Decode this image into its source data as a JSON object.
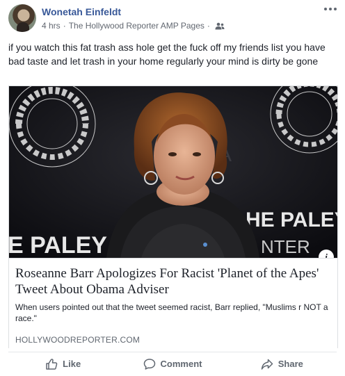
{
  "post": {
    "author": "Wonetah Einfeldt",
    "time": "4 hrs",
    "source": "The Hollywood Reporter AMP Pages",
    "separator": "·",
    "audience_icon": "people-icon",
    "text": "if you watch this fat trash ass hole get the fuck off my friends list you have bad taste and let trash in your home regularly your mind is dirty be gone"
  },
  "link_card": {
    "image_texts": {
      "left_seal": "MEDIA · FOR · CENTER · PALEY",
      "right_seal": "MEDIA · FOR · CENTER · PALEY",
      "top_banner": "E PALEY",
      "right_banner_1": "HE PALEY",
      "right_banner_2": "NTER",
      "left_banner": "E PALEY"
    },
    "info_label": "i",
    "headline": "Roseanne Barr Apologizes For Racist 'Planet of the Apes' Tweet About Obama Adviser",
    "snippet": "When users pointed out that the tweet seemed racist, Barr replied, \"Muslims r NOT a race.\"",
    "domain": "HOLLYWOODREPORTER.COM"
  },
  "actions": {
    "like": "Like",
    "comment": "Comment",
    "share": "Share"
  },
  "colors": {
    "author_link": "#385898",
    "meta_gray": "#616770",
    "border": "#dddfe2"
  }
}
